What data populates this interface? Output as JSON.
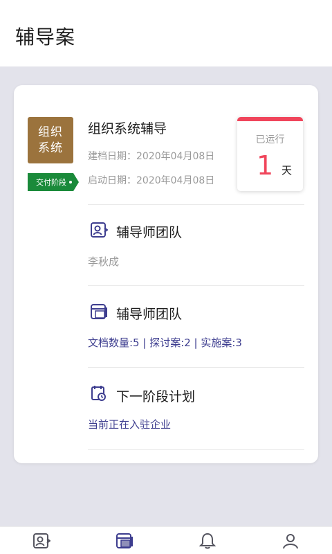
{
  "header": {
    "title": "辅导案"
  },
  "colors": {
    "accent": "#3d3d8f",
    "tile": "#9b733d",
    "stage": "#1a8a3a",
    "run_accent": "#f0455b",
    "background": "#e3e3eb"
  },
  "project": {
    "tile_line1": "组织",
    "tile_line2": "系统",
    "stage_label": "交付阶段",
    "name": "组织系统辅导",
    "created": "建档日期：2020年04月08日",
    "started": "启动日期：2020年04月08日",
    "running_label": "已运行",
    "running_days": "1",
    "running_unit": "天"
  },
  "sections": [
    {
      "icon": "team-icon",
      "title": "辅导师团队",
      "subtitle": "李秋成"
    },
    {
      "icon": "document-icon",
      "title": "辅导师团队",
      "subtitle": "文档数量:5 | 探讨案:2 | 实施案:3"
    },
    {
      "icon": "calendar-plan-icon",
      "title": "下一阶段计划",
      "subtitle": "当前正在入驻企业"
    }
  ],
  "tabbar": {
    "tabs": [
      {
        "icon": "team-icon",
        "active": false
      },
      {
        "icon": "document-icon",
        "active": true
      },
      {
        "icon": "bell-icon",
        "active": false
      },
      {
        "icon": "user-icon",
        "active": false
      }
    ]
  }
}
